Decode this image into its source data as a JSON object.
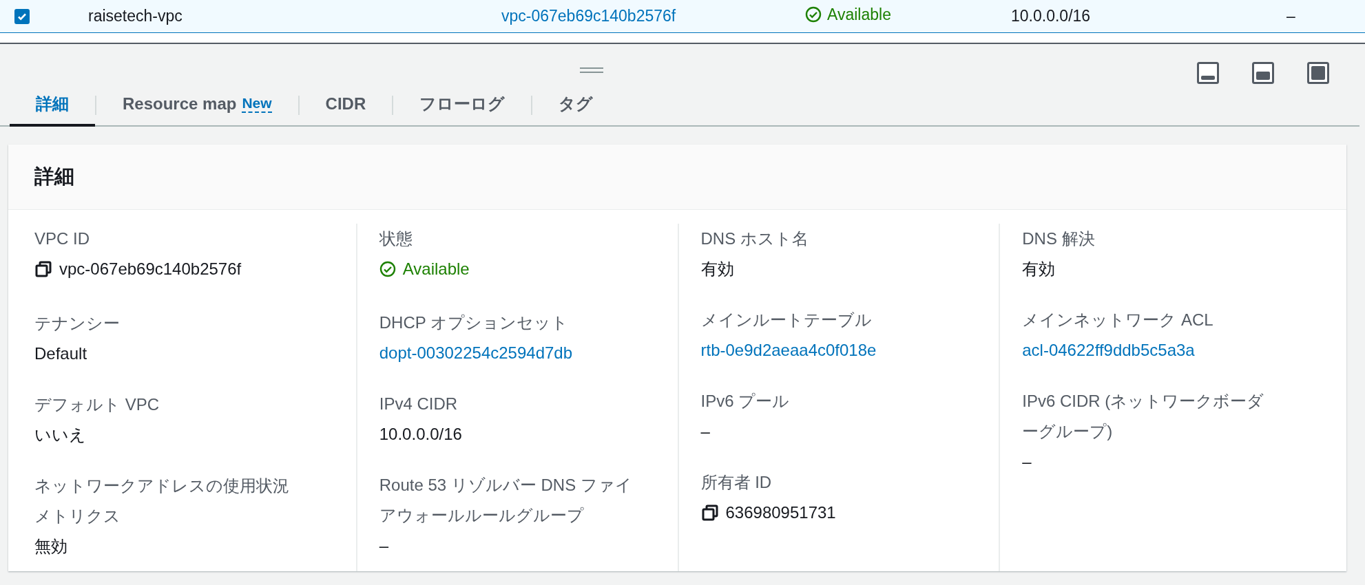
{
  "table_row": {
    "selected": true,
    "cells": [
      {
        "kind": "text",
        "text": "raisetech-vpc"
      },
      {
        "kind": "link",
        "text": "vpc-067eb69c140b2576f"
      },
      {
        "kind": "status",
        "text": "Available"
      },
      {
        "kind": "text",
        "text": "10.0.0.0/16"
      },
      {
        "kind": "text",
        "text": "–"
      }
    ]
  },
  "panel": {
    "tabs": [
      {
        "label": "詳細",
        "selected": true
      },
      {
        "label": "Resource map",
        "badge": "New",
        "selected": false
      },
      {
        "label": "CIDR",
        "selected": false
      },
      {
        "label": "フローログ",
        "selected": false
      },
      {
        "label": "タグ",
        "selected": false
      }
    ]
  },
  "details": {
    "title": "詳細",
    "columns": [
      [
        {
          "label": "VPC ID",
          "kind": "copy",
          "value": "vpc-067eb69c140b2576f"
        },
        {
          "label": "テナンシー",
          "kind": "text",
          "value": "Default"
        },
        {
          "label": "デフォルト VPC",
          "kind": "text",
          "value": "いいえ"
        },
        {
          "label": "ネットワークアドレスの使用状況メトリクス",
          "kind": "text",
          "value": "無効"
        }
      ],
      [
        {
          "label": "状態",
          "kind": "status",
          "value": "Available"
        },
        {
          "label": "DHCP オプションセット",
          "kind": "link",
          "value": "dopt-00302254c2594d7db"
        },
        {
          "label": "IPv4 CIDR",
          "kind": "text",
          "value": "10.0.0.0/16"
        },
        {
          "label": "Route 53 リゾルバー DNS ファイアウォールルールグループ",
          "kind": "text",
          "value": "–"
        }
      ],
      [
        {
          "label": "DNS ホスト名",
          "kind": "text",
          "value": "有効"
        },
        {
          "label": "メインルートテーブル",
          "kind": "link",
          "value": "rtb-0e9d2aeaa4c0f018e"
        },
        {
          "label": "IPv6 プール",
          "kind": "text",
          "value": "–"
        },
        {
          "label": "所有者 ID",
          "kind": "copy",
          "value": "636980951731"
        }
      ],
      [
        {
          "label": "DNS 解決",
          "kind": "text",
          "value": "有効"
        },
        {
          "label": "メインネットワーク ACL",
          "kind": "link",
          "value": "acl-04622ff9ddb5c5a3a"
        },
        {
          "label": "IPv6 CIDR (ネットワークボーダーグループ)",
          "kind": "text",
          "value": "–"
        }
      ]
    ]
  }
}
